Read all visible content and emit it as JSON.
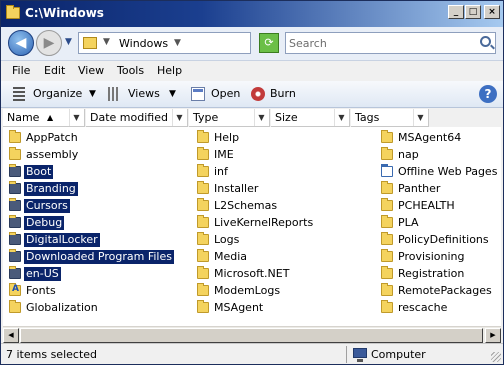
{
  "window": {
    "title": "C:\\Windows"
  },
  "address": {
    "path": "Windows",
    "search_placeholder": "Search"
  },
  "menu": [
    "File",
    "Edit",
    "View",
    "Tools",
    "Help"
  ],
  "toolbar": {
    "organize": "Organize",
    "views": "Views",
    "open": "Open",
    "burn": "Burn"
  },
  "columns": [
    "Name",
    "Date modified",
    "Type",
    "Size",
    "Tags"
  ],
  "files": {
    "col1": [
      {
        "name": "AppPatch",
        "selected": false
      },
      {
        "name": "assembly",
        "selected": false
      },
      {
        "name": "Boot",
        "selected": true
      },
      {
        "name": "Branding",
        "selected": true
      },
      {
        "name": "Cursors",
        "selected": true
      },
      {
        "name": "Debug",
        "selected": true
      },
      {
        "name": "DigitalLocker",
        "selected": true
      },
      {
        "name": "Downloaded Program Files",
        "selected": true
      },
      {
        "name": "en-US",
        "selected": true
      },
      {
        "name": "Fonts",
        "selected": false
      },
      {
        "name": "Globalization",
        "selected": false
      }
    ],
    "col2": [
      {
        "name": "Help"
      },
      {
        "name": "IME"
      },
      {
        "name": "inf"
      },
      {
        "name": "Installer"
      },
      {
        "name": "L2Schemas"
      },
      {
        "name": "LiveKernelReports"
      },
      {
        "name": "Logs"
      },
      {
        "name": "Media"
      },
      {
        "name": "Microsoft.NET"
      },
      {
        "name": "ModemLogs"
      },
      {
        "name": "MSAgent"
      }
    ],
    "col3": [
      {
        "name": "MSAgent64"
      },
      {
        "name": "nap"
      },
      {
        "name": "Offline Web Pages"
      },
      {
        "name": "Panther"
      },
      {
        "name": "PCHEALTH"
      },
      {
        "name": "PLA"
      },
      {
        "name": "PolicyDefinitions"
      },
      {
        "name": "Provisioning"
      },
      {
        "name": "Registration"
      },
      {
        "name": "RemotePackages"
      },
      {
        "name": "rescache"
      }
    ]
  },
  "status": {
    "selection": "7 items selected",
    "location": "Computer"
  }
}
